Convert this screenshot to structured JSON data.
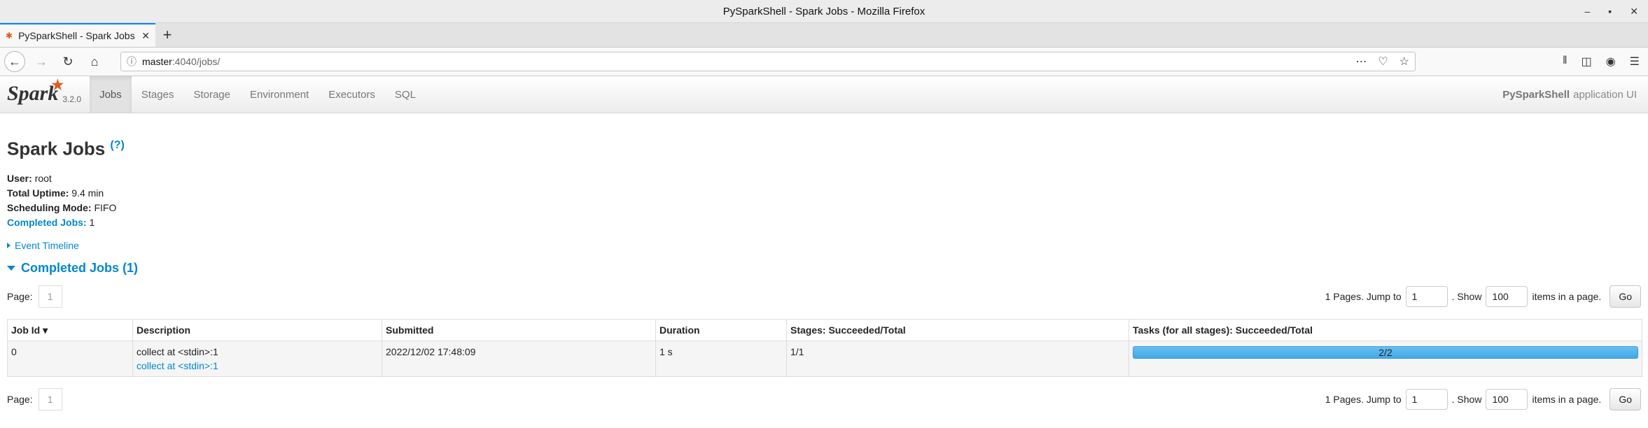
{
  "window": {
    "title": "PySparkShell - Spark Jobs - Mozilla Firefox"
  },
  "tab": {
    "label": "PySparkShell - Spark Jobs"
  },
  "url": {
    "host": "master",
    "path": ":4040/jobs/"
  },
  "spark_nav": {
    "version": "3.2.0",
    "items": [
      "Jobs",
      "Stages",
      "Storage",
      "Environment",
      "Executors",
      "SQL"
    ],
    "app_name": "PySparkShell",
    "app_suffix": "application UI"
  },
  "page": {
    "title": "Spark Jobs",
    "help": "(?)",
    "user_label": "User:",
    "user": "root",
    "uptime_label": "Total Uptime:",
    "uptime": "9.4 min",
    "sched_label": "Scheduling Mode:",
    "sched": "FIFO",
    "completed_label": "Completed Jobs:",
    "completed": "1",
    "event_timeline": "Event Timeline",
    "section_title": "Completed Jobs (1)"
  },
  "pager": {
    "page_label": "Page:",
    "page_num": "1",
    "pages_text": "1 Pages. Jump to",
    "jump_value": "1",
    "show_text": ". Show",
    "show_value": "100",
    "items_text": "items in a page.",
    "go": "Go"
  },
  "table": {
    "headers": [
      "Job Id ▾",
      "Description",
      "Submitted",
      "Duration",
      "Stages: Succeeded/Total",
      "Tasks (for all stages): Succeeded/Total"
    ],
    "row": {
      "job_id": "0",
      "desc": "collect at <stdin>:1",
      "desc_link": "collect at <stdin>:1",
      "submitted": "2022/12/02 17:48:09",
      "duration": "1 s",
      "stages": "1/1",
      "tasks": "2/2",
      "tasks_fraction": 1.0
    }
  }
}
